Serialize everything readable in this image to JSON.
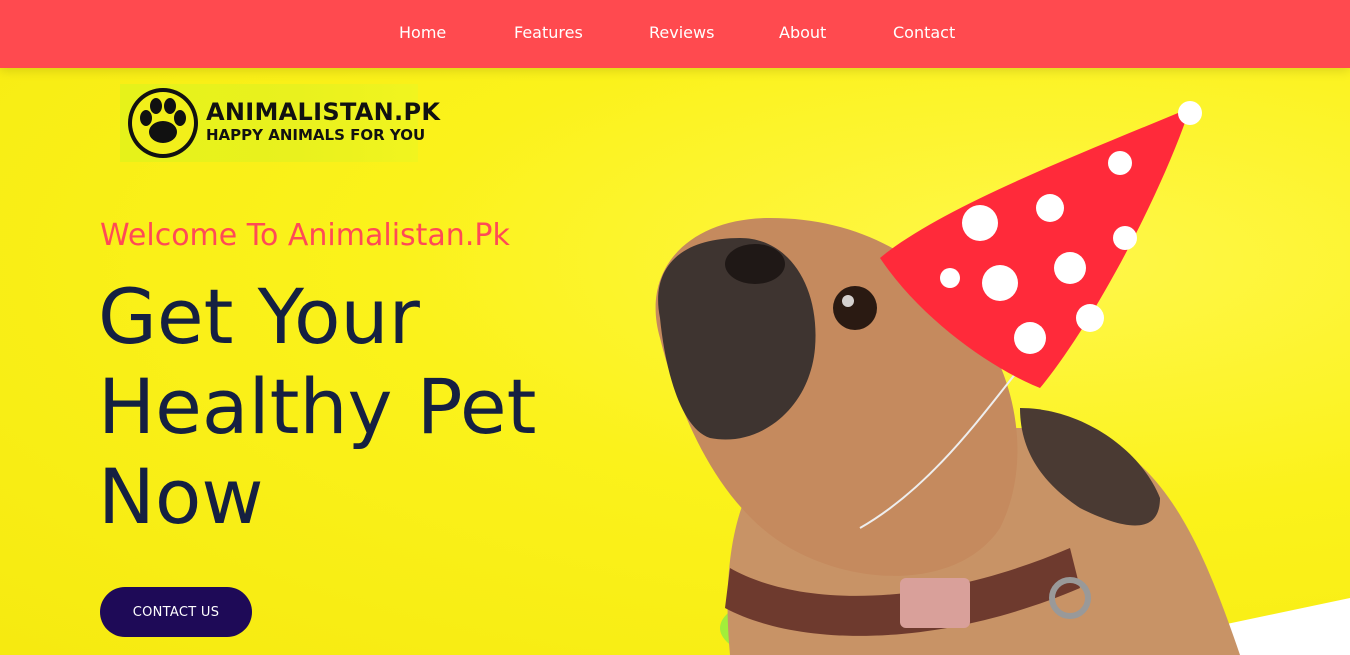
{
  "nav": {
    "items": [
      {
        "label": "Home"
      },
      {
        "label": "Features"
      },
      {
        "label": "Reviews"
      },
      {
        "label": "About"
      },
      {
        "label": "Contact"
      }
    ]
  },
  "logo": {
    "title": "ANIMALISTAN.PK",
    "tagline": "HAPPY ANIMALS FOR YOU"
  },
  "hero": {
    "welcome": "Welcome To Animalistan.Pk",
    "headline_line1": "Get Your",
    "headline_line2": "Healthy Pet",
    "headline_line3": "Now",
    "cta_label": "CONTACT US"
  },
  "colors": {
    "nav_bg": "#ff4a4f",
    "hero_bg": "#fbf21b",
    "welcome_text": "#ff4a56",
    "headline_text": "#152041",
    "cta_bg": "#1e0a57"
  },
  "icons": {
    "logo": "paw-print-icon",
    "hero_image": "pug-party-hat-image"
  }
}
